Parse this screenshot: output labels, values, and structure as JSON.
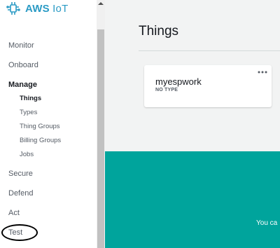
{
  "app": {
    "brand_bold": "AWS",
    "brand_light": "IoT",
    "logo_icon": "aws-iot-logo-icon",
    "accent_color": "#2b9bc5"
  },
  "sidebar": {
    "monitor": "Monitor",
    "onboard": "Onboard",
    "manage": "Manage",
    "manage_items": [
      {
        "label": "Things",
        "selected": true
      },
      {
        "label": "Types",
        "selected": false
      },
      {
        "label": "Thing Groups",
        "selected": false
      },
      {
        "label": "Billing Groups",
        "selected": false
      },
      {
        "label": "Jobs",
        "selected": false
      }
    ],
    "secure": "Secure",
    "defend": "Defend",
    "act": "Act",
    "test": "Test"
  },
  "main": {
    "title": "Things",
    "card": {
      "name": "myespwork",
      "type": "NO TYPE",
      "menu_icon": "more-options-icon"
    },
    "banner": {
      "text": "You ca",
      "color": "#00a49c"
    }
  }
}
